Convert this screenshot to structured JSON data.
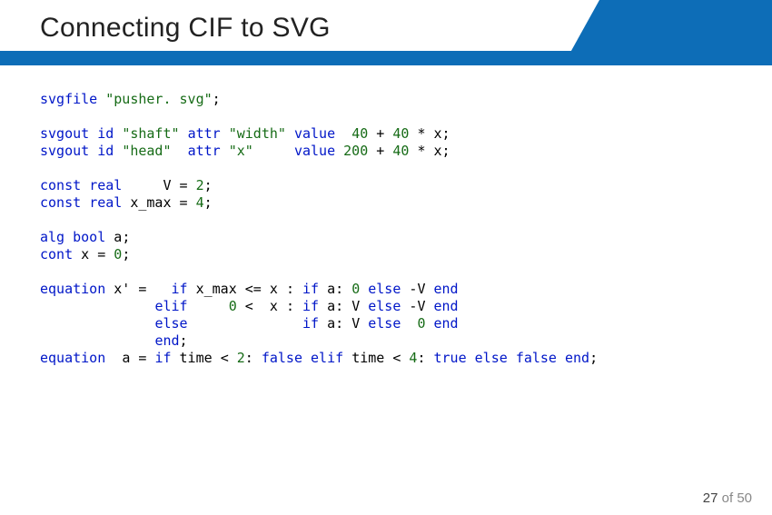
{
  "header": {
    "title": "Connecting CIF to SVG"
  },
  "code": {
    "kw": {
      "svgfile": "svgfile",
      "svgout": "svgout",
      "id": "id",
      "attr": "attr",
      "value": "value",
      "const": "const",
      "real": "real",
      "alg": "alg",
      "bool": "bool",
      "cont": "cont",
      "equation": "equation",
      "if": "if",
      "elif": "elif",
      "else": "else",
      "end": "end",
      "true": "true",
      "false": "false"
    },
    "str": {
      "pusher_svg": "\"pusher. svg\"",
      "shaft": "\"shaft\"",
      "head": "\"head\"",
      "width": "\"width\"",
      "x": "\"x\""
    },
    "id": {
      "V": "V",
      "x_max": "x_max",
      "a": "a",
      "x": "x",
      "xprime": "x'",
      "time": "time"
    },
    "num": {
      "n40a": "40",
      "n40b": "40",
      "n40c": "40",
      "n200": "200",
      "n2": "2",
      "n2b": "2",
      "n4": "4",
      "n4b": "4",
      "n0a": "0",
      "n0b": "0",
      "n0c": "0",
      "n0d": "0"
    },
    "sym": {
      "semi": ";",
      "plus": "+",
      "star": "*",
      "eq": "=",
      "le": "<=",
      "lt": "<",
      "colon": ":",
      "minus": "-"
    }
  },
  "footer": {
    "current": "27",
    "of": "of",
    "total": "50"
  }
}
